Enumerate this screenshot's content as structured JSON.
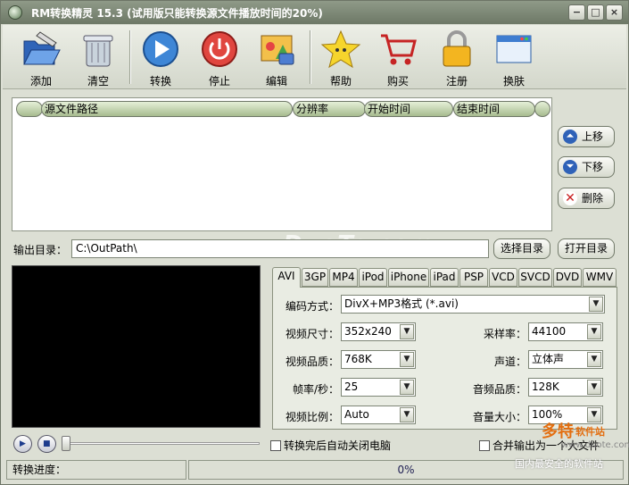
{
  "window": {
    "title": "RM转换精灵 15.3 (试用版只能转换源文件播放时间的20%)"
  },
  "window_controls": {
    "minimize": "−",
    "maximize": "□",
    "close": "×"
  },
  "toolbar": {
    "add": "添加",
    "clear": "清空",
    "convert": "转换",
    "stop": "停止",
    "edit": "编辑",
    "help": "帮助",
    "buy": "购买",
    "register": "注册",
    "skin": "换肤"
  },
  "filelist": {
    "columns": [
      "源文件路径",
      "分辨率",
      "开始时间",
      "结束时间"
    ]
  },
  "side_buttons": {
    "up": "上移",
    "down": "下移",
    "delete": "删除"
  },
  "output": {
    "label": "输出目录：",
    "path": "C:\\OutPath\\",
    "choose": "选择目录",
    "open": "打开目录"
  },
  "watermark": "www.DuoTe.com",
  "tabs": [
    "AVI",
    "3GP",
    "MP4",
    "iPod",
    "iPhone",
    "iPad",
    "PSP",
    "VCD",
    "SVCD",
    "DVD",
    "WMV"
  ],
  "settings": {
    "codec_label": "编码方式：",
    "codec_value": "DivX+MP3格式 (*.avi)",
    "size_label": "视频尺寸：",
    "size_value": "352x240",
    "samplerate_label": "采样率：",
    "samplerate_value": "44100",
    "vquality_label": "视频品质：",
    "vquality_value": "768K",
    "channel_label": "声道：",
    "channel_value": "立体声",
    "fps_label": "帧率/秒：",
    "fps_value": "25",
    "aquality_label": "音频品质：",
    "aquality_value": "128K",
    "ratio_label": "视频比例：",
    "ratio_value": "Auto",
    "volume_label": "音量大小：",
    "volume_value": "100%"
  },
  "checks": {
    "shutdown": "转换完后自动关闭电脑",
    "merge": "合并输出为一个大文件"
  },
  "status": {
    "label": "转换进度：",
    "percent": "0%"
  },
  "logo": {
    "name": "多特",
    "sub": "软件站",
    "url": "www.duote.com",
    "slogan": "国内最安全的软件站"
  },
  "colors": {
    "titlebar": "#7a8573",
    "panel": "#dcdfd4",
    "tab_active": "#e9ece3"
  }
}
